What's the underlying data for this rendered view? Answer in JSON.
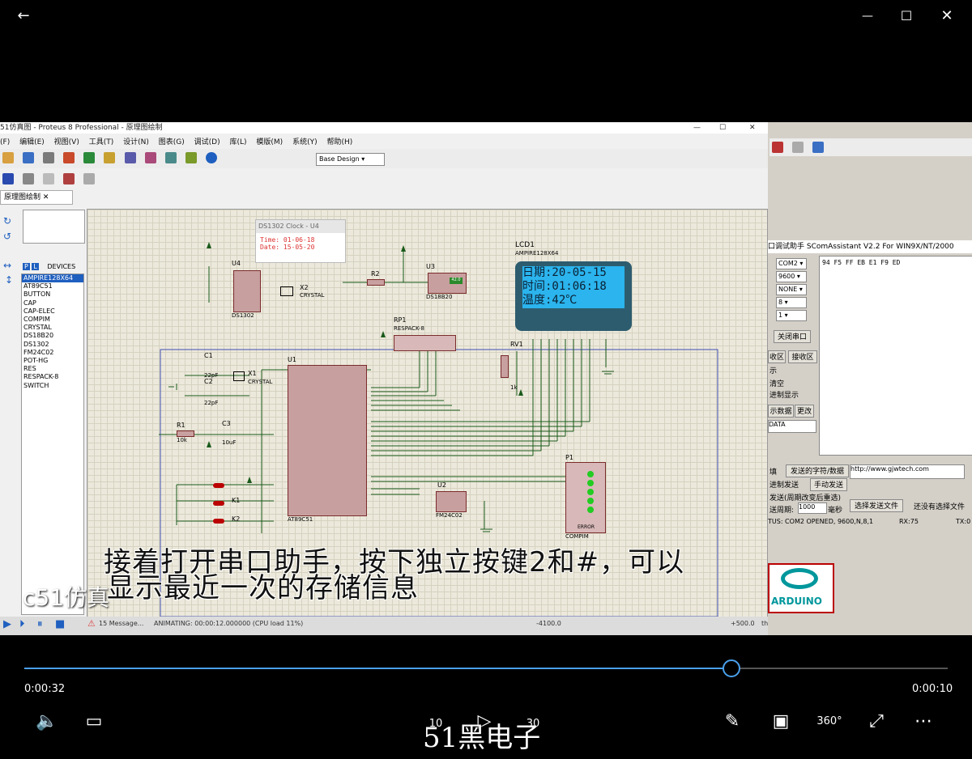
{
  "window": {
    "back_glyph": "←",
    "min_glyph": "—",
    "max_glyph": "☐",
    "close_glyph": "✕"
  },
  "proteus": {
    "title": "51仿真图 - Proteus 8 Professional - 原理图绘制",
    "menu": [
      "(F)",
      "编辑(E)",
      "视图(V)",
      "工具(T)",
      "设计(N)",
      "图表(G)",
      "调试(D)",
      "库(L)",
      "模版(M)",
      "系统(Y)",
      "帮助(H)"
    ],
    "base_design": "Base Design",
    "tab": "原理图绘制",
    "devices_label": "DEVICES",
    "devices": [
      "AMPIRE128X64",
      "AT89C51",
      "BUTTON",
      "CAP",
      "CAP-ELEC",
      "COMPIM",
      "CRYSTAL",
      "DS18B20",
      "DS1302",
      "FM24C02",
      "POT-HG",
      "RES",
      "RESPACK-8",
      "SWITCH"
    ],
    "status": {
      "messages": "15 Message...",
      "animating": "ANIMATING: 00:00:12.000000 (CPU load 11%)",
      "coord_x": "-4100.0",
      "coord_y": "+500.0",
      "th": "th"
    }
  },
  "popup": {
    "title": "DS1302 Clock - U4",
    "time": "Time:  01-06-18",
    "date": "Date:  15-05-20"
  },
  "lcd": {
    "ref": "LCD1",
    "part": "AMPIRE128X64",
    "line1": "日期:20-05-15",
    "line2": "时间:01:06:18",
    "line3": "温度:42℃"
  },
  "schematic": {
    "u1": "U1",
    "u1_part": "AT89C51",
    "u2": "U2",
    "u2_part": "FM24C02",
    "u3": "U3",
    "u3_part": "DS18B20",
    "u3_val": "42.0",
    "u4": "U4",
    "u4_part": "DS1302",
    "x1": "X1",
    "x2": "X2",
    "crystal": "CRYSTAL",
    "c1": "C1",
    "c2": "C2",
    "c3": "C3",
    "r1": "R1",
    "r2": "R2",
    "rp1": "RP1",
    "rp1_part": "RESPACK-8",
    "rv1": "RV1",
    "p1": "P1",
    "p1_part": "COMPIM",
    "error": "ERROR",
    "v22pf": "22pF",
    "v10k": "10k",
    "v10uf": "10uF",
    "v1k": "1k",
    "k1": "K1",
    "k2": "K2"
  },
  "serial": {
    "title": "口调试助手 SComAssistant V2.2 For WIN9X/NT/2000",
    "port": "COM2",
    "baud": "9600",
    "parity": "NONE",
    "databits": "8",
    "stopbits": "1",
    "close_port": "关闭串口",
    "recv_area": "收区",
    "recv_btn": "接收区",
    "show": "示",
    "clear": "清空",
    "hex_show": "进制显示",
    "send_data": "示数据",
    "change": "更改",
    "data": "DATA",
    "received": "94 F5 FF EB E1 F9 ED",
    "send_chars": "发送的字符/数据",
    "send_area_lbl": "填",
    "hex_send": "进制发送",
    "manual_send": "手动发送",
    "auto_send": "发送(周期改变后重选)",
    "period_lbl": "送周期:",
    "period": "1000",
    "ms": "毫秒",
    "url": "http://www.gjwtech.com",
    "select_file": "选择发送文件",
    "no_file": "还没有选择文件",
    "status": "TUS: COM2 OPENED, 9600,N,8,1",
    "rx": "RX:75",
    "tx": "TX:0",
    "arduino": "ARDUINO"
  },
  "subtitle": {
    "line1": "接着打开串口助手，按下独立按键2和#，可以",
    "line2": "显示最近一次的存储信息"
  },
  "watermark": "c51仿真",
  "player": {
    "elapsed": "0:00:32",
    "remaining": "0:00:10",
    "progress": 0.765,
    "brand": "51黑电子",
    "skip_back": "10",
    "skip_fwd": "30",
    "icons": {
      "volume": "volume-icon",
      "subtitles": "subtitles-icon",
      "play": "play-icon",
      "edit": "pencil-icon",
      "mini": "mini-view-icon",
      "vr": "360-icon",
      "fullscreen": "fullscreen-icon",
      "more": "more-icon"
    }
  }
}
